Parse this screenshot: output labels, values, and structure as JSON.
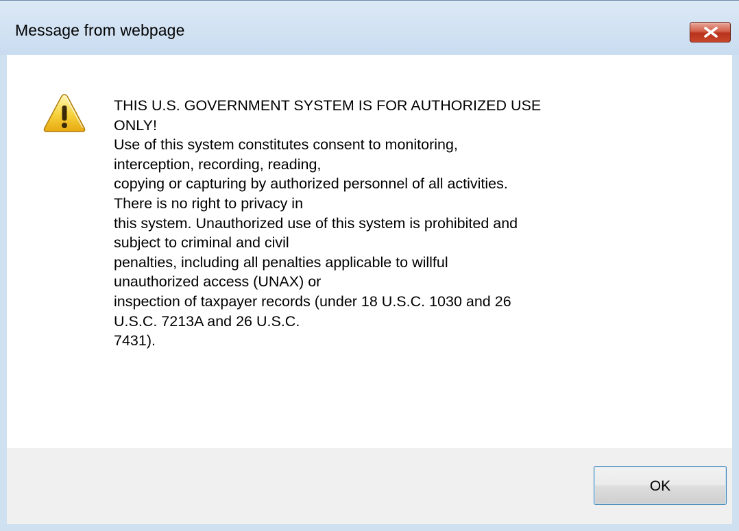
{
  "window": {
    "title": "Message from webpage",
    "close_icon": "close-x-icon"
  },
  "message": {
    "icon": "warning-triangle-icon",
    "lines": [
      "THIS U.S. GOVERNMENT SYSTEM IS FOR AUTHORIZED USE",
      "ONLY!",
      "Use of this system constitutes consent to monitoring,",
      "interception, recording, reading,",
      "copying or capturing by authorized personnel of all activities.",
      "There is no right to privacy in",
      "this system.  Unauthorized use of this system is prohibited and",
      "subject to criminal and civil",
      "penalties, including all penalties applicable to willful",
      "unauthorized access (UNAX) or",
      "inspection of taxpayer records (under 18 U.S.C. 1030 and 26",
      "U.S.C. 7213A and 26 U.S.C.",
      "7431)."
    ]
  },
  "buttons": {
    "ok_label": "OK"
  },
  "colors": {
    "frame": "#cfe0f1",
    "close_button": "#c9472c",
    "footer": "#f0f0f0",
    "ok_border": "#3c7fb1"
  }
}
